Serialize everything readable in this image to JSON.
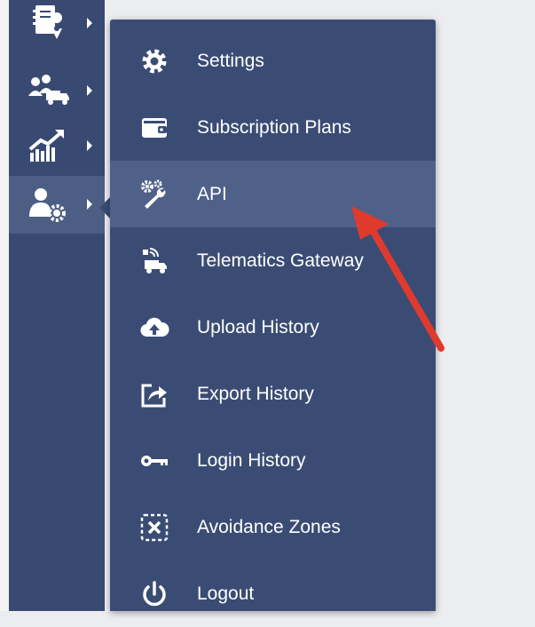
{
  "sidebar": {
    "items": [
      {
        "icon": "address-book-location-icon",
        "active": false
      },
      {
        "icon": "users-truck-icon",
        "active": false
      },
      {
        "icon": "analytics-chart-icon",
        "active": false
      },
      {
        "icon": "user-settings-icon",
        "active": true
      }
    ]
  },
  "menu": {
    "items": [
      {
        "label": "Settings",
        "icon": "gear-icon"
      },
      {
        "label": "Subscription Plans",
        "icon": "wallet-icon"
      },
      {
        "label": "API",
        "icon": "wrench-gears-icon",
        "active": true
      },
      {
        "label": "Telematics Gateway",
        "icon": "telematics-truck-icon"
      },
      {
        "label": "Upload History",
        "icon": "cloud-upload-icon"
      },
      {
        "label": "Export History",
        "icon": "export-icon"
      },
      {
        "label": "Login History",
        "icon": "key-icon"
      },
      {
        "label": "Avoidance Zones",
        "icon": "avoidance-zone-icon"
      },
      {
        "label": "Logout",
        "icon": "power-icon"
      }
    ]
  },
  "annotation": {
    "color": "#e03a2f",
    "target": "API"
  },
  "colors": {
    "sidebar": "#394a72",
    "menu": "#3b4c74",
    "active": "#4f6089",
    "background": "#ecedf0"
  }
}
